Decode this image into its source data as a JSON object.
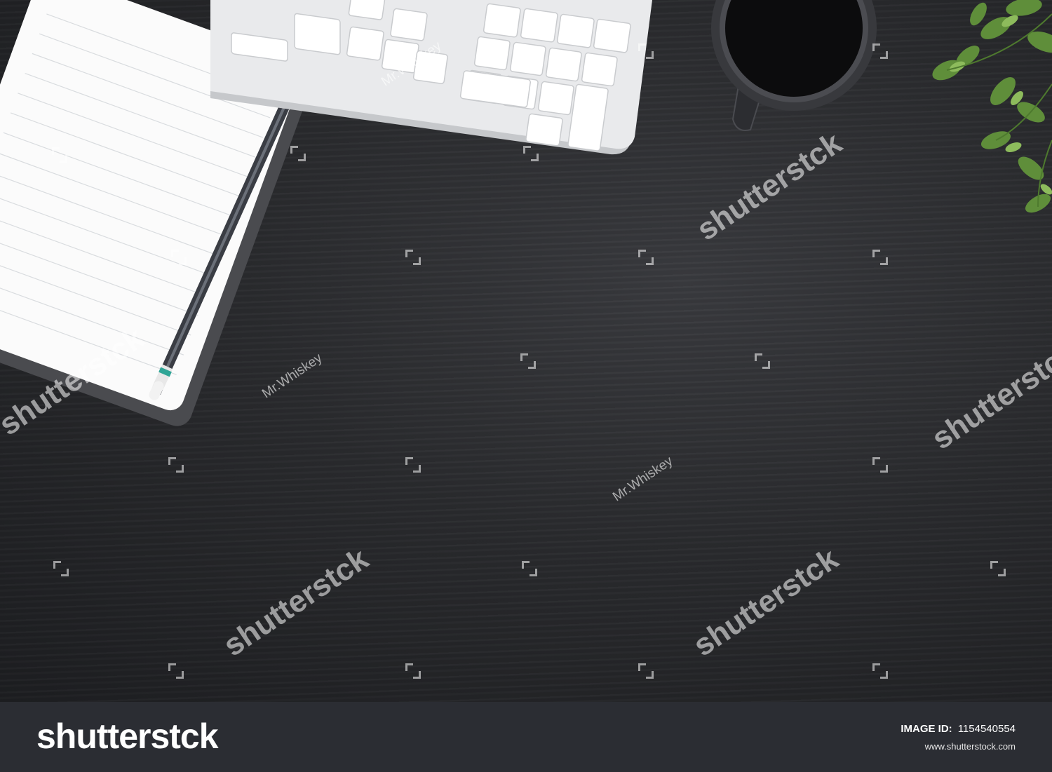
{
  "scene": {
    "subject": "dark-wood-desk-flatlay",
    "objects": [
      "notebook",
      "pencil",
      "keyboard",
      "coffee-mug",
      "plant"
    ],
    "colors": {
      "desk": "#2a2b2e",
      "paper": "#fbfbfb",
      "keyboard": "#e9eaec",
      "pencil": "#3a3d44",
      "plant": "#5f8e3a",
      "footer": "#2b2d33"
    }
  },
  "watermarks": {
    "brand": "shutterstck",
    "author": "Mr.Whiskey"
  },
  "footer": {
    "logo": "shutterstck",
    "id_label": "IMAGE ID:",
    "id_value": "1154540554",
    "url": "www.shutterstock.com"
  }
}
